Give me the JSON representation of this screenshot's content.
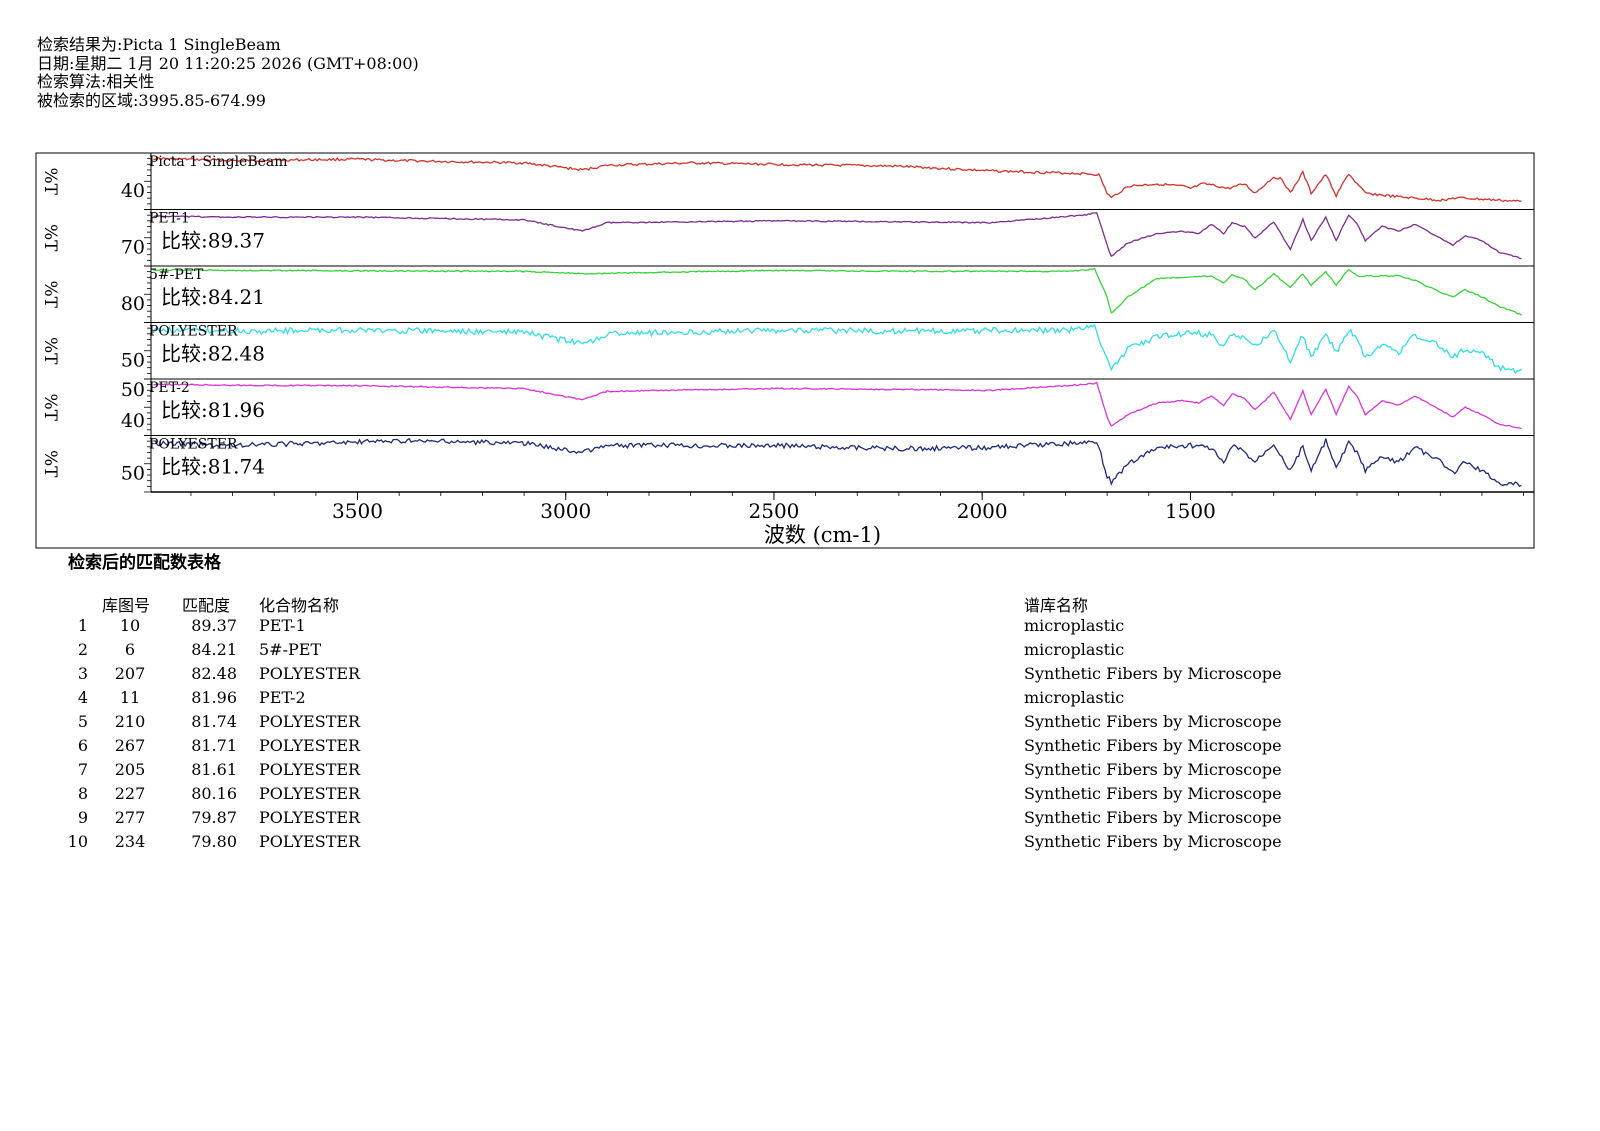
{
  "header": {
    "line1": "检索结果为:Picta 1 SingleBeam",
    "line2": "日期:星期二 1月 20 11:20:25 2026 (GMT+08:00)",
    "line3": "检索算法:相关性",
    "line4": "被检索的区域:3995.85-674.99"
  },
  "chart_data": {
    "type": "line",
    "xlabel": "波数 (cm-1)",
    "x_ticks": [
      3500,
      3000,
      2500,
      2000,
      1500
    ],
    "xlim": [
      3995.85,
      674.99
    ],
    "y_axis_label": "%T",
    "series": [
      {
        "name": "Picta 1 SingleBeam",
        "compare": "",
        "color": "#d2322d",
        "yticks": [
          "40"
        ],
        "wiggle": 0.4,
        "points": [
          [
            3990,
            0.95
          ],
          [
            3800,
            0.9
          ],
          [
            3500,
            0.93
          ],
          [
            3400,
            0.9
          ],
          [
            3100,
            0.85
          ],
          [
            2960,
            0.7
          ],
          [
            2900,
            0.8
          ],
          [
            2700,
            0.85
          ],
          [
            2500,
            0.82
          ],
          [
            2200,
            0.78
          ],
          [
            1980,
            0.68
          ],
          [
            1750,
            0.62
          ],
          [
            1720,
            0.6
          ],
          [
            1700,
            0.2
          ],
          [
            1690,
            0.1
          ],
          [
            1650,
            0.35
          ],
          [
            1580,
            0.4
          ],
          [
            1520,
            0.35
          ],
          [
            1500,
            0.3
          ],
          [
            1470,
            0.4
          ],
          [
            1450,
            0.38
          ],
          [
            1410,
            0.3
          ],
          [
            1370,
            0.4
          ],
          [
            1345,
            0.2
          ],
          [
            1300,
            0.55
          ],
          [
            1280,
            0.5
          ],
          [
            1260,
            0.2
          ],
          [
            1230,
            0.65
          ],
          [
            1210,
            0.2
          ],
          [
            1175,
            0.6
          ],
          [
            1150,
            0.15
          ],
          [
            1120,
            0.62
          ],
          [
            1100,
            0.4
          ],
          [
            1080,
            0.2
          ],
          [
            1000,
            0.12
          ],
          [
            900,
            0.05
          ],
          [
            860,
            0.1
          ],
          [
            700,
            0.02
          ]
        ]
      },
      {
        "name": "PET-1",
        "compare": "比较:89.37",
        "color": "#7b2d8e",
        "yticks": [
          "70"
        ],
        "wiggle": 0.2,
        "points": [
          [
            3990,
            0.92
          ],
          [
            3800,
            0.9
          ],
          [
            3500,
            0.9
          ],
          [
            3100,
            0.84
          ],
          [
            2960,
            0.6
          ],
          [
            2900,
            0.78
          ],
          [
            2500,
            0.82
          ],
          [
            2200,
            0.8
          ],
          [
            1980,
            0.78
          ],
          [
            1750,
            0.95
          ],
          [
            1725,
            1.0
          ],
          [
            1700,
            0.3
          ],
          [
            1690,
            0.05
          ],
          [
            1650,
            0.35
          ],
          [
            1580,
            0.55
          ],
          [
            1520,
            0.6
          ],
          [
            1480,
            0.55
          ],
          [
            1450,
            0.75
          ],
          [
            1420,
            0.55
          ],
          [
            1400,
            0.78
          ],
          [
            1370,
            0.7
          ],
          [
            1345,
            0.45
          ],
          [
            1300,
            0.8
          ],
          [
            1260,
            0.2
          ],
          [
            1230,
            0.85
          ],
          [
            1210,
            0.4
          ],
          [
            1175,
            0.9
          ],
          [
            1150,
            0.4
          ],
          [
            1120,
            0.95
          ],
          [
            1100,
            0.75
          ],
          [
            1080,
            0.4
          ],
          [
            1040,
            0.7
          ],
          [
            1000,
            0.6
          ],
          [
            960,
            0.75
          ],
          [
            900,
            0.45
          ],
          [
            870,
            0.3
          ],
          [
            840,
            0.5
          ],
          [
            800,
            0.4
          ],
          [
            760,
            0.15
          ],
          [
            700,
            0.0
          ]
        ]
      },
      {
        "name": "5#-PET",
        "compare": "比较:84.21",
        "color": "#37d337",
        "yticks": [
          "80"
        ],
        "wiggle": 0.2,
        "points": [
          [
            3990,
            0.98
          ],
          [
            3800,
            0.97
          ],
          [
            3100,
            0.95
          ],
          [
            2960,
            0.9
          ],
          [
            2500,
            0.97
          ],
          [
            2100,
            0.95
          ],
          [
            1800,
            0.95
          ],
          [
            1730,
            1.0
          ],
          [
            1700,
            0.4
          ],
          [
            1690,
            0.05
          ],
          [
            1650,
            0.4
          ],
          [
            1580,
            0.8
          ],
          [
            1450,
            0.85
          ],
          [
            1420,
            0.7
          ],
          [
            1400,
            0.88
          ],
          [
            1370,
            0.78
          ],
          [
            1345,
            0.55
          ],
          [
            1300,
            0.9
          ],
          [
            1260,
            0.6
          ],
          [
            1230,
            0.9
          ],
          [
            1210,
            0.65
          ],
          [
            1175,
            0.95
          ],
          [
            1150,
            0.65
          ],
          [
            1120,
            1.0
          ],
          [
            1100,
            0.85
          ],
          [
            1000,
            0.85
          ],
          [
            960,
            0.75
          ],
          [
            900,
            0.5
          ],
          [
            870,
            0.4
          ],
          [
            840,
            0.55
          ],
          [
            800,
            0.4
          ],
          [
            760,
            0.2
          ],
          [
            700,
            0.0
          ]
        ]
      },
      {
        "name": "POLYESTER",
        "compare": "比较:82.48",
        "color": "#2fdfe6",
        "yticks": [
          "50"
        ],
        "wiggle": 1.0,
        "points": [
          [
            3990,
            0.9
          ],
          [
            3750,
            0.88
          ],
          [
            3600,
            0.9
          ],
          [
            3300,
            0.88
          ],
          [
            3100,
            0.85
          ],
          [
            2960,
            0.6
          ],
          [
            2900,
            0.82
          ],
          [
            2500,
            0.9
          ],
          [
            2200,
            0.88
          ],
          [
            1800,
            0.9
          ],
          [
            1730,
            0.95
          ],
          [
            1700,
            0.3
          ],
          [
            1690,
            0.05
          ],
          [
            1650,
            0.5
          ],
          [
            1580,
            0.75
          ],
          [
            1500,
            0.85
          ],
          [
            1450,
            0.8
          ],
          [
            1420,
            0.5
          ],
          [
            1400,
            0.85
          ],
          [
            1370,
            0.7
          ],
          [
            1345,
            0.55
          ],
          [
            1300,
            0.9
          ],
          [
            1260,
            0.2
          ],
          [
            1230,
            0.8
          ],
          [
            1210,
            0.3
          ],
          [
            1175,
            0.85
          ],
          [
            1150,
            0.4
          ],
          [
            1120,
            0.9
          ],
          [
            1100,
            0.7
          ],
          [
            1080,
            0.3
          ],
          [
            1040,
            0.6
          ],
          [
            1000,
            0.4
          ],
          [
            960,
            0.8
          ],
          [
            900,
            0.55
          ],
          [
            870,
            0.3
          ],
          [
            840,
            0.5
          ],
          [
            800,
            0.4
          ],
          [
            760,
            0.1
          ],
          [
            700,
            0.0
          ]
        ]
      },
      {
        "name": "PET-2",
        "compare": "比较:81.96",
        "color": "#d836d8",
        "yticks": [
          "50",
          "40"
        ],
        "wiggle": 0.2,
        "points": [
          [
            3990,
            0.95
          ],
          [
            3800,
            0.93
          ],
          [
            3500,
            0.92
          ],
          [
            3100,
            0.86
          ],
          [
            2960,
            0.62
          ],
          [
            2900,
            0.8
          ],
          [
            2500,
            0.86
          ],
          [
            2200,
            0.84
          ],
          [
            1980,
            0.82
          ],
          [
            1750,
            0.95
          ],
          [
            1725,
            0.98
          ],
          [
            1700,
            0.25
          ],
          [
            1690,
            0.05
          ],
          [
            1650,
            0.3
          ],
          [
            1580,
            0.55
          ],
          [
            1520,
            0.6
          ],
          [
            1480,
            0.55
          ],
          [
            1450,
            0.7
          ],
          [
            1420,
            0.5
          ],
          [
            1400,
            0.75
          ],
          [
            1370,
            0.65
          ],
          [
            1345,
            0.4
          ],
          [
            1300,
            0.78
          ],
          [
            1260,
            0.2
          ],
          [
            1230,
            0.8
          ],
          [
            1210,
            0.3
          ],
          [
            1175,
            0.85
          ],
          [
            1150,
            0.3
          ],
          [
            1120,
            0.9
          ],
          [
            1100,
            0.7
          ],
          [
            1080,
            0.3
          ],
          [
            1040,
            0.6
          ],
          [
            1000,
            0.5
          ],
          [
            960,
            0.7
          ],
          [
            900,
            0.4
          ],
          [
            870,
            0.25
          ],
          [
            840,
            0.45
          ],
          [
            800,
            0.3
          ],
          [
            760,
            0.1
          ],
          [
            700,
            0.0
          ]
        ]
      },
      {
        "name": "POLYESTER",
        "compare": "比较:81.74",
        "color": "#1f2a7a",
        "yticks": [
          "50"
        ],
        "wiggle": 0.8,
        "points": [
          [
            3990,
            0.9
          ],
          [
            3800,
            0.85
          ],
          [
            3600,
            0.9
          ],
          [
            3400,
            0.95
          ],
          [
            3100,
            0.9
          ],
          [
            2960,
            0.7
          ],
          [
            2900,
            0.85
          ],
          [
            2500,
            0.85
          ],
          [
            2200,
            0.78
          ],
          [
            2000,
            0.8
          ],
          [
            1750,
            0.92
          ],
          [
            1725,
            0.95
          ],
          [
            1700,
            0.2
          ],
          [
            1690,
            0.05
          ],
          [
            1650,
            0.45
          ],
          [
            1580,
            0.8
          ],
          [
            1500,
            0.85
          ],
          [
            1450,
            0.8
          ],
          [
            1420,
            0.45
          ],
          [
            1400,
            0.85
          ],
          [
            1370,
            0.7
          ],
          [
            1345,
            0.5
          ],
          [
            1300,
            0.9
          ],
          [
            1260,
            0.3
          ],
          [
            1230,
            0.85
          ],
          [
            1210,
            0.3
          ],
          [
            1175,
            0.95
          ],
          [
            1150,
            0.35
          ],
          [
            1120,
            0.9
          ],
          [
            1100,
            0.7
          ],
          [
            1080,
            0.3
          ],
          [
            1040,
            0.6
          ],
          [
            1000,
            0.5
          ],
          [
            960,
            0.8
          ],
          [
            900,
            0.5
          ],
          [
            870,
            0.25
          ],
          [
            840,
            0.5
          ],
          [
            800,
            0.3
          ],
          [
            760,
            0.05
          ],
          [
            700,
            0.0
          ]
        ]
      }
    ]
  },
  "table": {
    "title": "检索后的匹配数表格",
    "headers": {
      "num": "库图号",
      "score": "匹配度",
      "name": "化合物名称",
      "library": "谱库名称"
    },
    "rows": [
      {
        "idx": "1",
        "num": "10",
        "score": "89.37",
        "name": "PET-1",
        "library": "microplastic"
      },
      {
        "idx": "2",
        "num": "6",
        "score": "84.21",
        "name": "5#-PET",
        "library": "microplastic"
      },
      {
        "idx": "3",
        "num": "207",
        "score": "82.48",
        "name": "POLYESTER",
        "library": "Synthetic Fibers by Microscope"
      },
      {
        "idx": "4",
        "num": "11",
        "score": "81.96",
        "name": "PET-2",
        "library": "microplastic"
      },
      {
        "idx": "5",
        "num": "210",
        "score": "81.74",
        "name": "POLYESTER",
        "library": "Synthetic Fibers by Microscope"
      },
      {
        "idx": "6",
        "num": "267",
        "score": "81.71",
        "name": "POLYESTER",
        "library": "Synthetic Fibers by Microscope"
      },
      {
        "idx": "7",
        "num": "205",
        "score": "81.61",
        "name": "POLYESTER",
        "library": "Synthetic Fibers by Microscope"
      },
      {
        "idx": "8",
        "num": "227",
        "score": "80.16",
        "name": "POLYESTER",
        "library": "Synthetic Fibers by Microscope"
      },
      {
        "idx": "9",
        "num": "277",
        "score": "79.87",
        "name": "POLYESTER",
        "library": "Synthetic Fibers by Microscope"
      },
      {
        "idx": "10",
        "num": "234",
        "score": "79.80",
        "name": "POLYESTER",
        "library": "Synthetic Fibers by Microscope"
      }
    ]
  }
}
